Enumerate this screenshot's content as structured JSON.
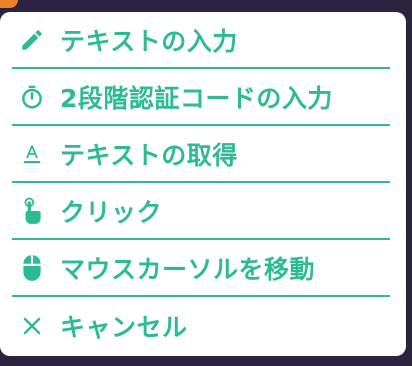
{
  "menu": {
    "accent_color": "#2dbb93",
    "items": [
      {
        "label": "テキストの入力",
        "icon": "pencil-icon"
      },
      {
        "label": "2段階認証コードの入力",
        "icon": "stopwatch-icon"
      },
      {
        "label": "テキストの取得",
        "icon": "text-underline-icon"
      },
      {
        "label": "クリック",
        "icon": "pointer-hand-icon"
      },
      {
        "label": "マウスカーソルを移動",
        "icon": "mouse-icon"
      },
      {
        "label": "キャンセル",
        "icon": "close-icon"
      }
    ]
  }
}
